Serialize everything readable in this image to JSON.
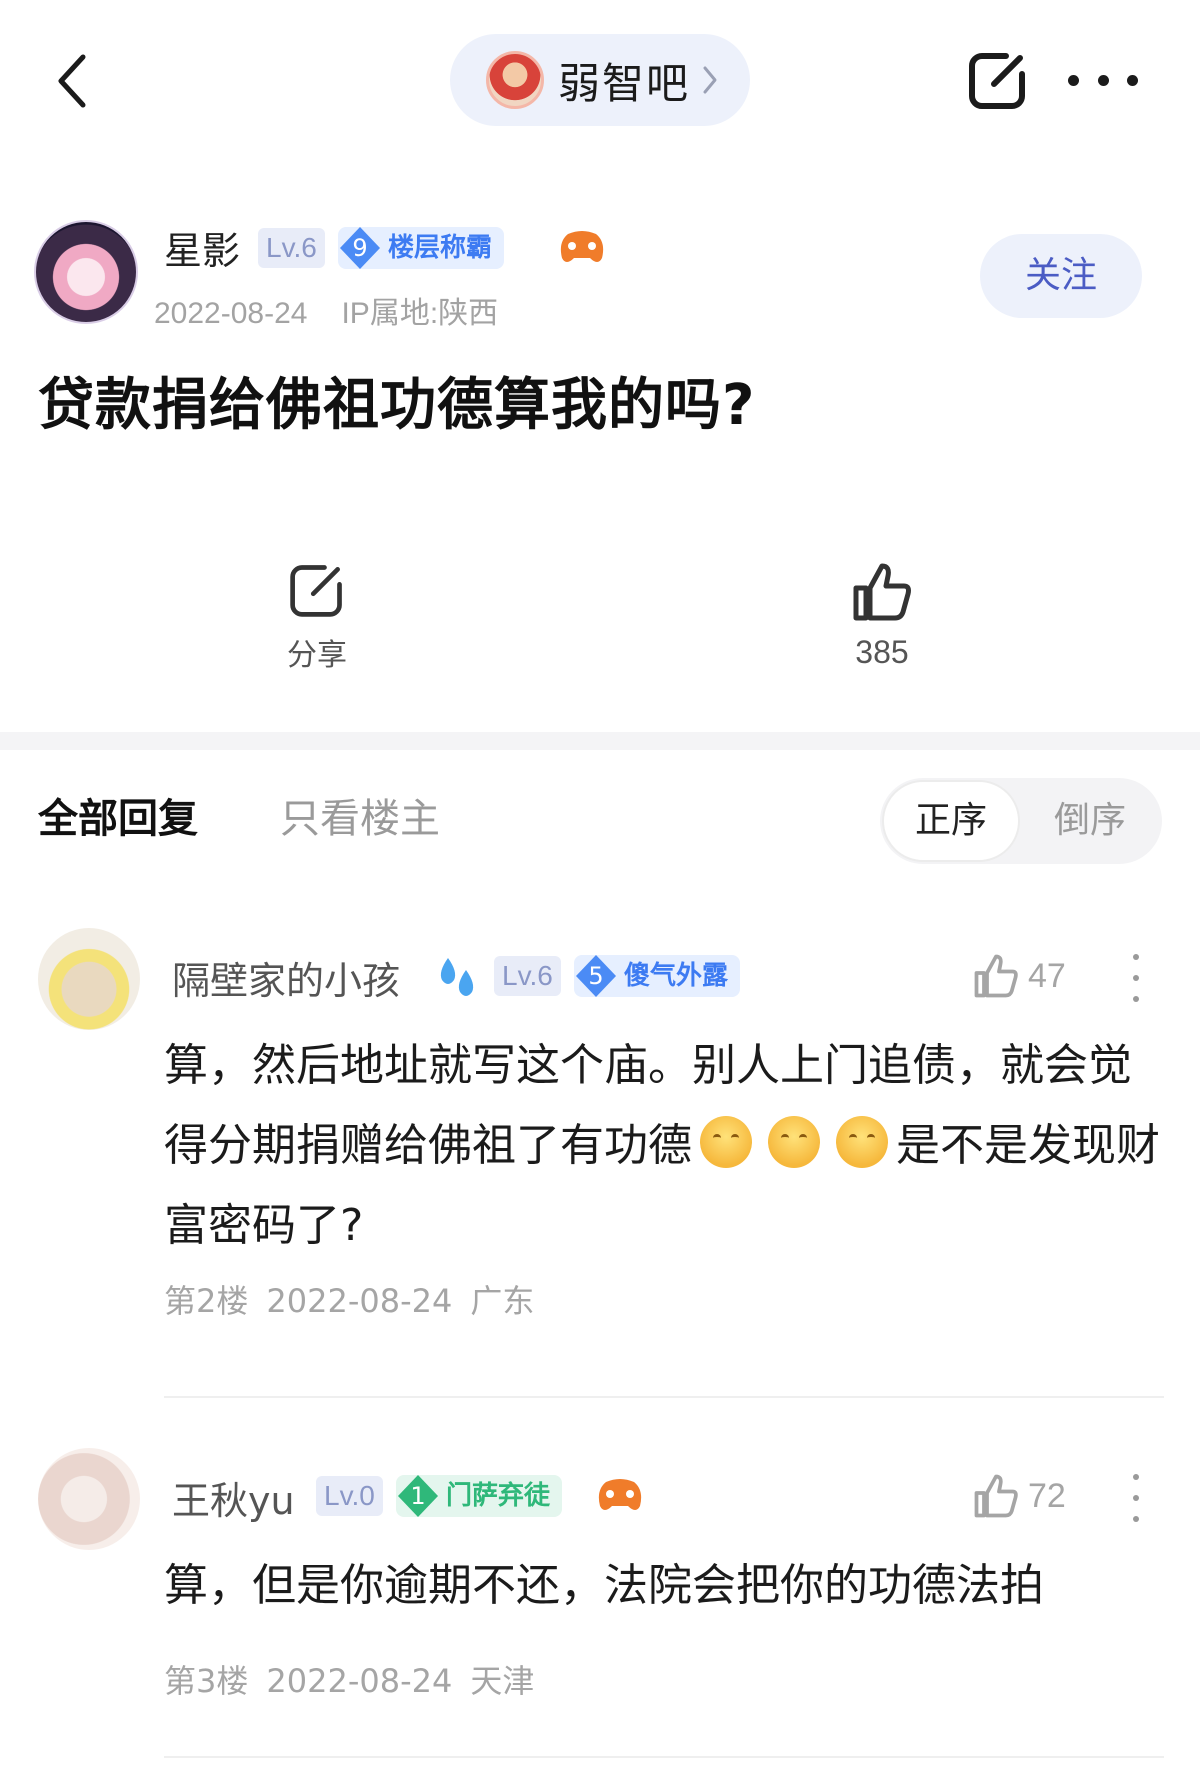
{
  "nav": {
    "forum_name": "弱智吧",
    "back_icon": "chevron-left-icon",
    "edit_icon": "edit-icon",
    "more_icon": "more-horizontal-icon"
  },
  "post": {
    "author": {
      "name": "星影",
      "level": "Lv.6",
      "title_level": "9",
      "title": "楼层称霸",
      "date": "2022-08-24",
      "ip": "IP属地:陕西",
      "follow_label": "关注"
    },
    "title": "贷款捐给佛祖功德算我的吗?",
    "share_label": "分享",
    "like_count": "385"
  },
  "tabs": {
    "all": "全部回复",
    "owner_only": "只看楼主",
    "sort_asc": "正序",
    "sort_desc": "倒序"
  },
  "comments": [
    {
      "name": "隔壁家的小孩",
      "level": "Lv.6",
      "title_level": "5",
      "title": "傻气外露",
      "title_color": "#3d7bf2",
      "likes": "47",
      "body_part1": "算，然后地址就写这个庙。别人上门追债，就会觉得分期捐赠给佛祖了有功德",
      "body_part2": "是不是发现财富密码了?",
      "floor": "第2楼",
      "date": "2022-08-24",
      "location": "广东"
    },
    {
      "name": "王秋yu",
      "level": "Lv.0",
      "title_level": "1",
      "title": "门萨弃徒",
      "title_color": "#2fb87a",
      "likes": "72",
      "body": "算，但是你逾期不还，法院会把你的功德法拍",
      "floor": "第3楼",
      "date": "2022-08-24",
      "location": "天津"
    }
  ],
  "colors": {
    "accent": "#4b5cc4",
    "badge_blue": "#3d7bf2",
    "badge_green": "#2fb87a",
    "muted": "#a5a5a5"
  }
}
